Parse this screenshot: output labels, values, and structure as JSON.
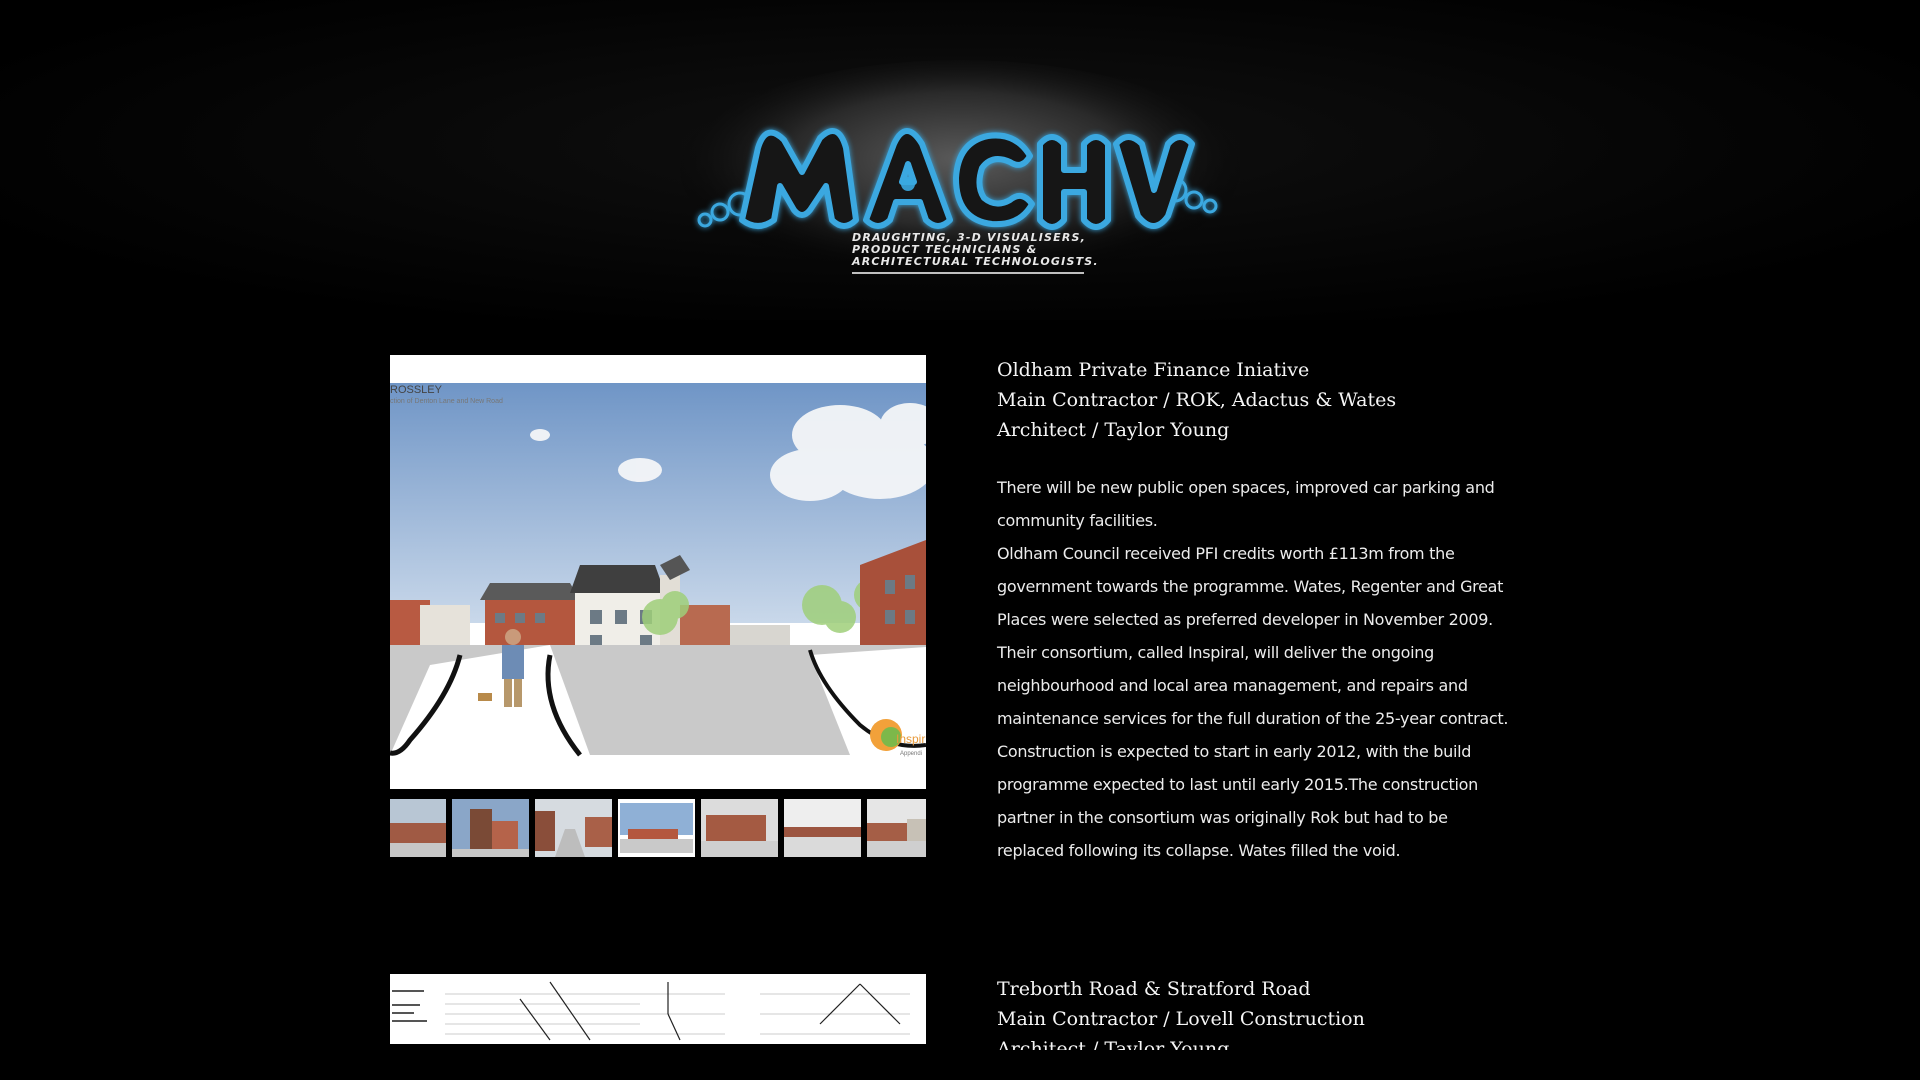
{
  "header": {
    "logo_text": "MACH",
    "tagline_lines": [
      "Draughting, 3-D Visualisers,",
      "Product Technicians &",
      "Architectural Technologists."
    ]
  },
  "projects": [
    {
      "heading_lines": [
        "Oldham Private Finance Iniative",
        "Main Contractor / ROK, Adactus & Wates",
        "Architect / Taylor Young"
      ],
      "image": {
        "caption_title": "ROSSLEY",
        "caption_sub": "ction of Denton Lane and New Road",
        "brand": "Inspir",
        "brand_sub": "Appendi"
      },
      "thumbnail_count": 7,
      "active_thumbnail": 4,
      "description_lines": [
        "There will be new public open spaces, improved car parking and",
        "community facilities.",
        "Oldham Council received PFI credits worth £113m from the",
        "government towards the programme. Wates, Regenter and Great",
        "Places were selected as preferred developer in November 2009.",
        "Their consortium, called Inspiral, will deliver the ongoing",
        "neighbourhood and local area management, and repairs and",
        "maintenance services for the full duration of the 25-year contract.",
        "Construction is expected to start in early 2012, with the build",
        "programme expected to last until early 2015.The construction",
        "partner in the consortium was originally Rok but had to be",
        "replaced following its collapse. Wates filled the void."
      ]
    },
    {
      "heading_lines": [
        "Treborth Road & Stratford Road",
        "Main Contractor / Lovell Construction",
        "Architect / Taylor Young"
      ]
    }
  ],
  "colors": {
    "background": "#000000",
    "logo_glow": "#3aa8e0",
    "text": "#f2f2f2"
  }
}
